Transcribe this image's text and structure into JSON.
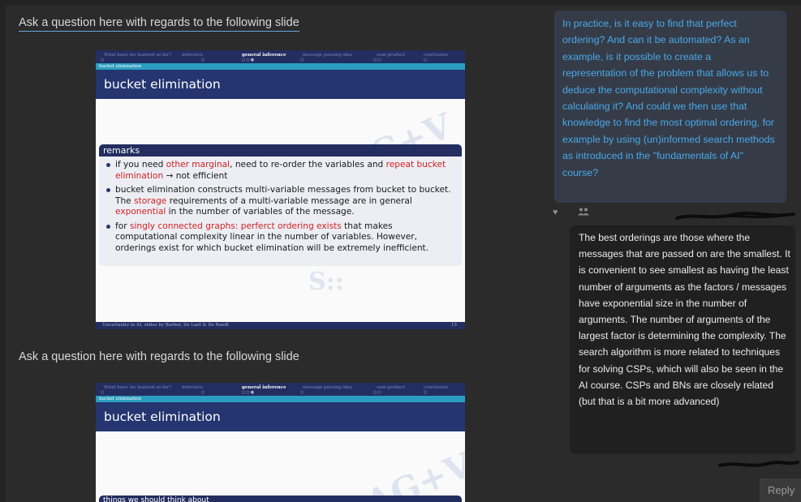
{
  "prompts": {
    "first": "Ask a question here with regards to the following slide",
    "second": "Ask a question here with regards to the following slide"
  },
  "slide1": {
    "nav": [
      "What have we learned so far?",
      "inference",
      "general inference",
      "message passing idea",
      "sum-product",
      "conclusion"
    ],
    "subheader": "bucket elimination",
    "title": "bucket elimination",
    "remarks_title": "remarks",
    "bullet1": {
      "t1": "if you need ",
      "r1": "other marginal",
      "t2": ", need to re-order the variables and ",
      "r2": "repeat bucket elimination",
      "t3": " → not efficient"
    },
    "bullet2": {
      "t1": "bucket elimination constructs multi-variable messages from bucket to bucket. The ",
      "r1": "storage",
      "t2": " requirements of a multi-variable message are in general ",
      "r2": "exponential",
      "t3": " in the number of variables of the message."
    },
    "bullet3": {
      "t1": "for ",
      "r1": "singly connected graphs: perferct ordering exists",
      "t2": " that makes computational complexity linear in the number of variables. However, orderings exist for which bucket elimination will be extremely inefficient."
    },
    "footer": "Uncertainty in AI, slides by Barber, De Laet & De Raedt",
    "page": "15"
  },
  "slide2": {
    "nav": [
      "What have we learned so far?",
      "inference",
      "general inference",
      "message passing idea",
      "sum-product",
      "conclusion"
    ],
    "subheader": "bucket elimination",
    "title": "bucket elimination",
    "partial_box": "things we should think about"
  },
  "question": {
    "text": "In practice, is it easy to find that perfect ordering? And can it be automated? As an example, is it possible to create a representation of the problem that allows us to deduce the computational complexity without calculating it? And could we then use that knowledge to find the most optimal ordering, for example by using (un)informed search methods as introduced in the \"fundamentals of AI\" course?"
  },
  "answer": {
    "text": "The best orderings are those where the messages that are passed on are the smallest. It is convenient to see smallest as having the least number of arguments as the factors / messages have exponential size in the number of arguments. The number of arguments of the largest factor is determining the complexity. The search algorithm is more related to techniques for solving CSPs, which will also be seen in the AI course. CSPs and BNs are closely related (but that is a bit more advanced)"
  },
  "icons": {
    "like": "heart-icon",
    "audience": "people-icon"
  },
  "reply_label": "Reply",
  "colors": {
    "background": "#2b2b2b",
    "question_bubble": "#353c48",
    "question_text": "#4aa8e8",
    "answer_bubble": "#202020",
    "slide_navy": "#232d60",
    "slide_teal": "#2a9ec0",
    "slide_red": "#d42020"
  }
}
